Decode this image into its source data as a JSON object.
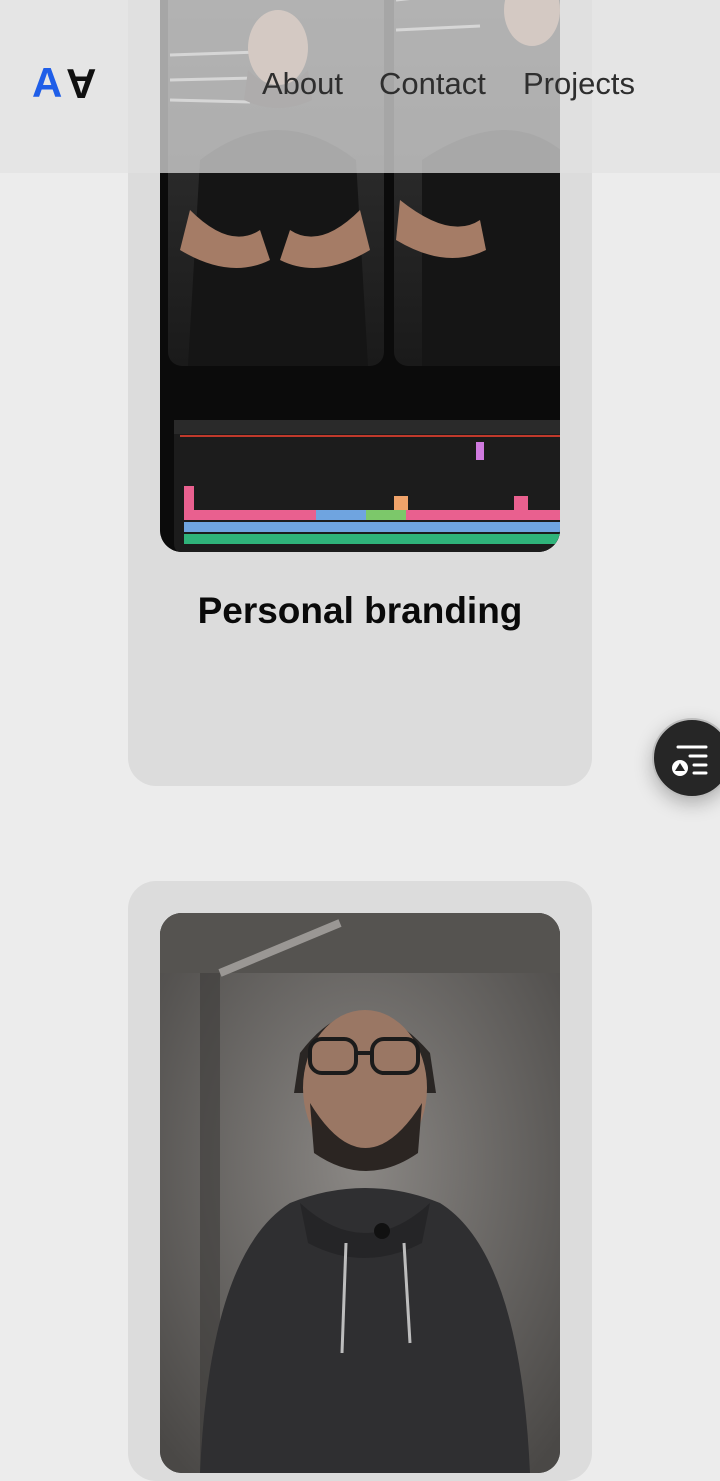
{
  "header": {
    "logo_left": "A",
    "logo_right": "A",
    "nav": [
      {
        "label": "About"
      },
      {
        "label": "Contact"
      },
      {
        "label": "Projects"
      }
    ]
  },
  "projects": [
    {
      "title": "Personal branding",
      "media": "video-editing-thumbnail"
    },
    {
      "title": "",
      "media": "talking-head-thumbnail"
    }
  ],
  "fab": {
    "icon": "filter-list-icon"
  },
  "colors": {
    "accent": "#1f5ee8",
    "background": "#ececec",
    "card": "#dcdcdc",
    "text": "#0a0a0a"
  }
}
